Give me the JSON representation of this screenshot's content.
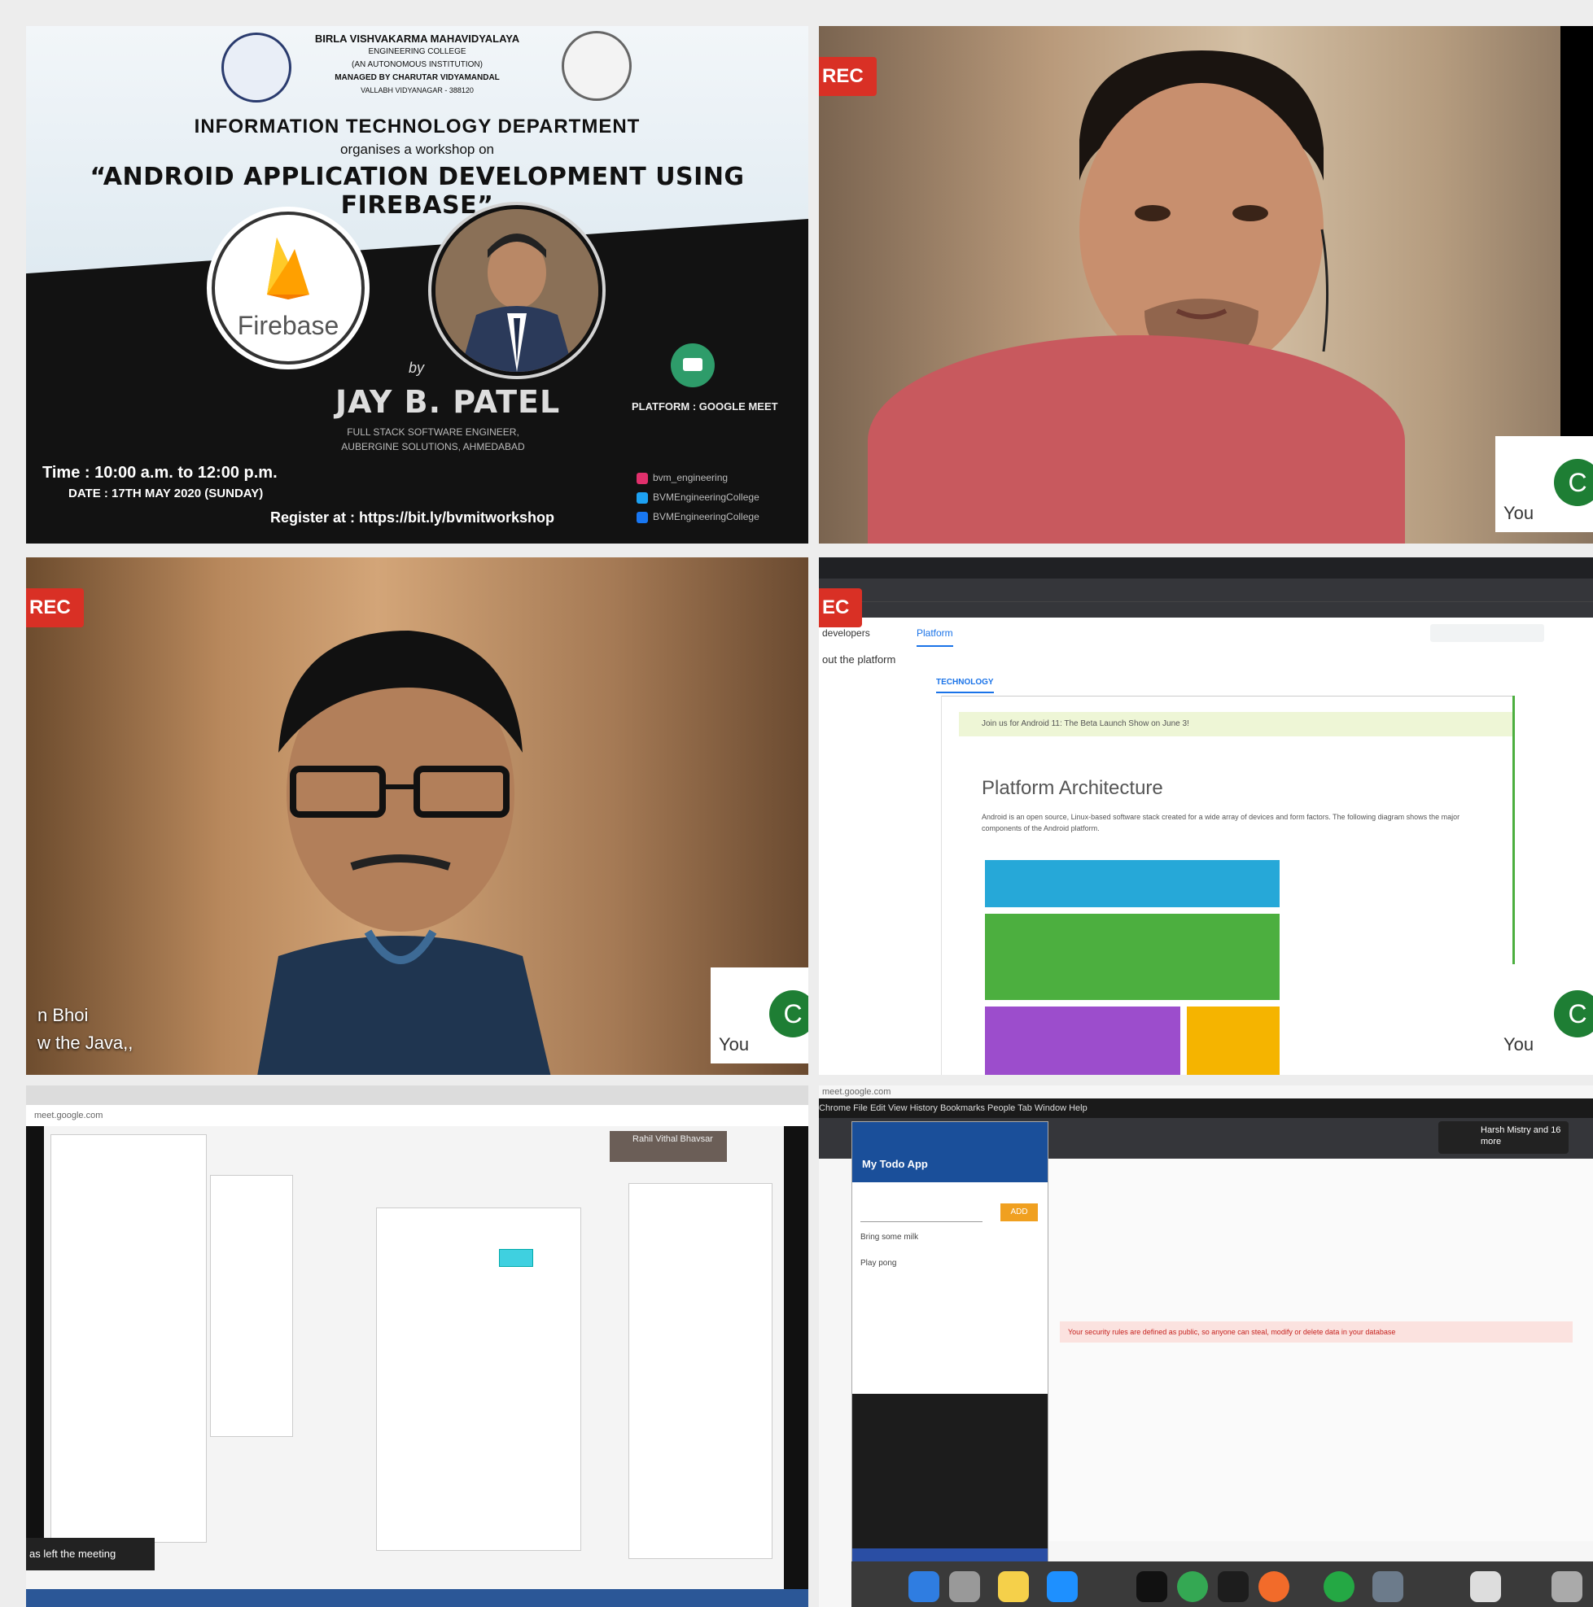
{
  "tile1": {
    "college_line1": "BIRLA VISHVAKARMA MAHAVIDYALAYA",
    "college_line2": "ENGINEERING COLLEGE",
    "college_line3": "(AN AUTONOMOUS INSTITUTION)",
    "college_line4": "MANAGED BY CHARUTAR VIDYAMANDAL",
    "college_line5": "VALLABH VIDYANAGAR - 388120",
    "department": "INFORMATION TECHNOLOGY DEPARTMENT",
    "organises": "organises a workshop on",
    "workshop_title": "“ANDROID APPLICATION DEVELOPMENT USING FIREBASE”",
    "firebase_word": "Firebase",
    "by": "by",
    "speaker_name": "JAY B. PATEL",
    "speaker_role1": "FULL STACK SOFTWARE ENGINEER,",
    "speaker_role2": "AUBERGINE SOLUTIONS, AHMEDABAD",
    "platform": "PLATFORM : GOOGLE MEET",
    "time": "Time : 10:00 a.m. to 12:00 p.m.",
    "date": "DATE : 17TH MAY 2020 (SUNDAY)",
    "register": "Register at : https://bit.ly/bvmitworkshop",
    "social": [
      "bvm_engineering",
      "BVMEngineeringCollege",
      "BVMEngineeringCollege"
    ]
  },
  "tile2": {
    "rec": "REC",
    "avatar_letter": "C",
    "self_label": "You"
  },
  "tile3": {
    "rec": "REC",
    "avatar_letter": "C",
    "self_label": "You",
    "name_line1": "n Bhoi",
    "name_line2": "w the Java,,"
  },
  "tile4": {
    "rec": "EC",
    "avatar_letter": "C",
    "self_label": "You",
    "site_nav_left": "developers",
    "site_nav_tab": "Platform",
    "breadcrumb": "out the platform",
    "sub_tab": "TECHNOLOGY",
    "banner": "Join us for Android 11: The Beta Launch Show on June 3!",
    "page_title": "Platform Architecture",
    "description": "Android is an open source, Linux-based software stack created for a wide array of devices and form factors. The following diagram shows the major components of the Android platform."
  },
  "tile5": {
    "url": "meet.google.com",
    "left_msg": "as left the meeting",
    "toast": "Rahil Vithal Bhavsar"
  },
  "tile6": {
    "meet_url": "meet.google.com",
    "menubar": "Chrome  File  Edit  View  History  Bookmarks  People  Tab  Window  Help",
    "app_title": "My Todo App",
    "add_label": "ADD",
    "tasks": [
      "Bring some milk",
      "Play pong"
    ],
    "pill_text": "Harsh Mistry and 16 more",
    "warning": "Your security rules are defined as public, so anyone can steal, modify or delete data in your database"
  },
  "colors": {
    "rec_red": "#d93025",
    "avatar_green": "#1e7e34",
    "firebase_orange": "#ffa000",
    "meet_green": "#2e9c6a"
  }
}
